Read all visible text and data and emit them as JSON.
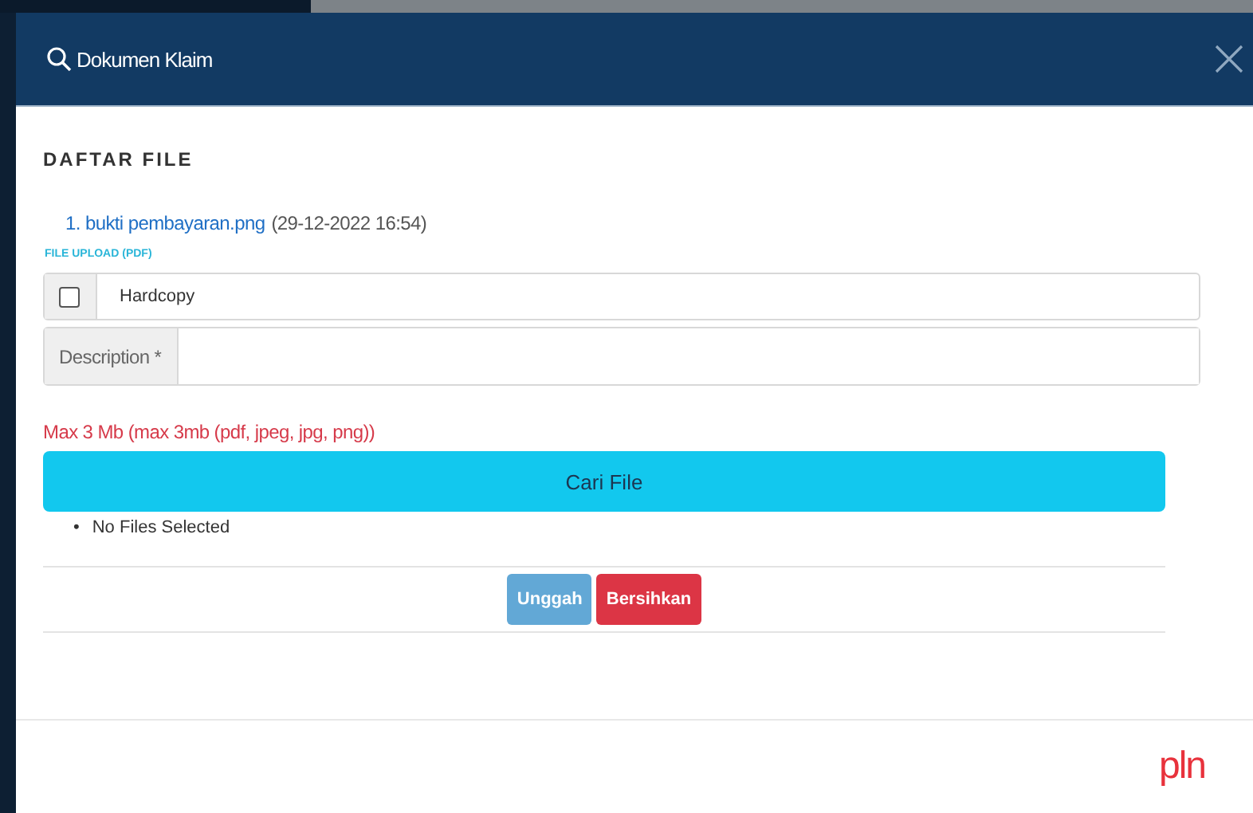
{
  "modal": {
    "title": "Dokumen Klaim"
  },
  "section_title": "DAFTAR FILE",
  "files": [
    {
      "name": "1. bukti pembayaran.png",
      "date": "(29-12-2022 16:54)"
    }
  ],
  "upload_label": "FILE UPLOAD (PDF)",
  "hardcopy": {
    "label": "Hardcopy",
    "checked": false
  },
  "description": {
    "label": "Description *"
  },
  "size_note": "Max 3 Mb (max 3mb (pdf, jpeg, jpg, png))",
  "browse_button": "Cari File",
  "selected_files": [
    {
      "marker": "•",
      "text": "No Files Selected"
    }
  ],
  "buttons": [
    {
      "label": "Unggah",
      "kind": "primary"
    },
    {
      "label": "Bersihkan",
      "kind": "danger"
    }
  ],
  "logo": "pln"
}
